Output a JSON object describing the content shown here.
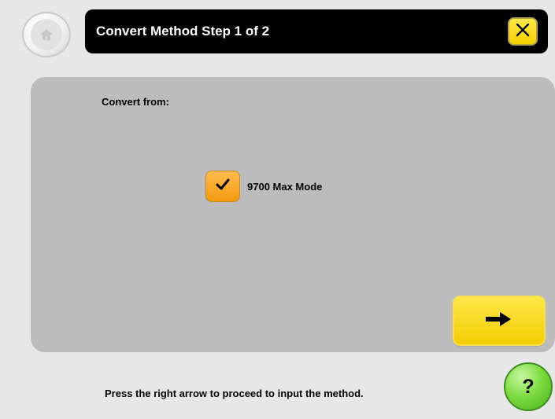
{
  "header": {
    "title": "Convert Method Step 1 of 2",
    "home_icon": "home-icon",
    "close_icon": "close-icon"
  },
  "panel": {
    "convert_from_label": "Convert from:",
    "option": {
      "label": "9700 Max Mode",
      "checked": true,
      "check_icon": "checkmark-icon"
    },
    "next_icon": "right-arrow-icon"
  },
  "footer": {
    "hint": "Press the right arrow to proceed to input the method.",
    "help_label": "?"
  },
  "colors": {
    "title_bar": "#000000",
    "panel": "#bcbcbc",
    "accent_yellow": "#f4cf00",
    "checkbox_orange": "#f39a10",
    "help_green": "#5ec72c"
  }
}
